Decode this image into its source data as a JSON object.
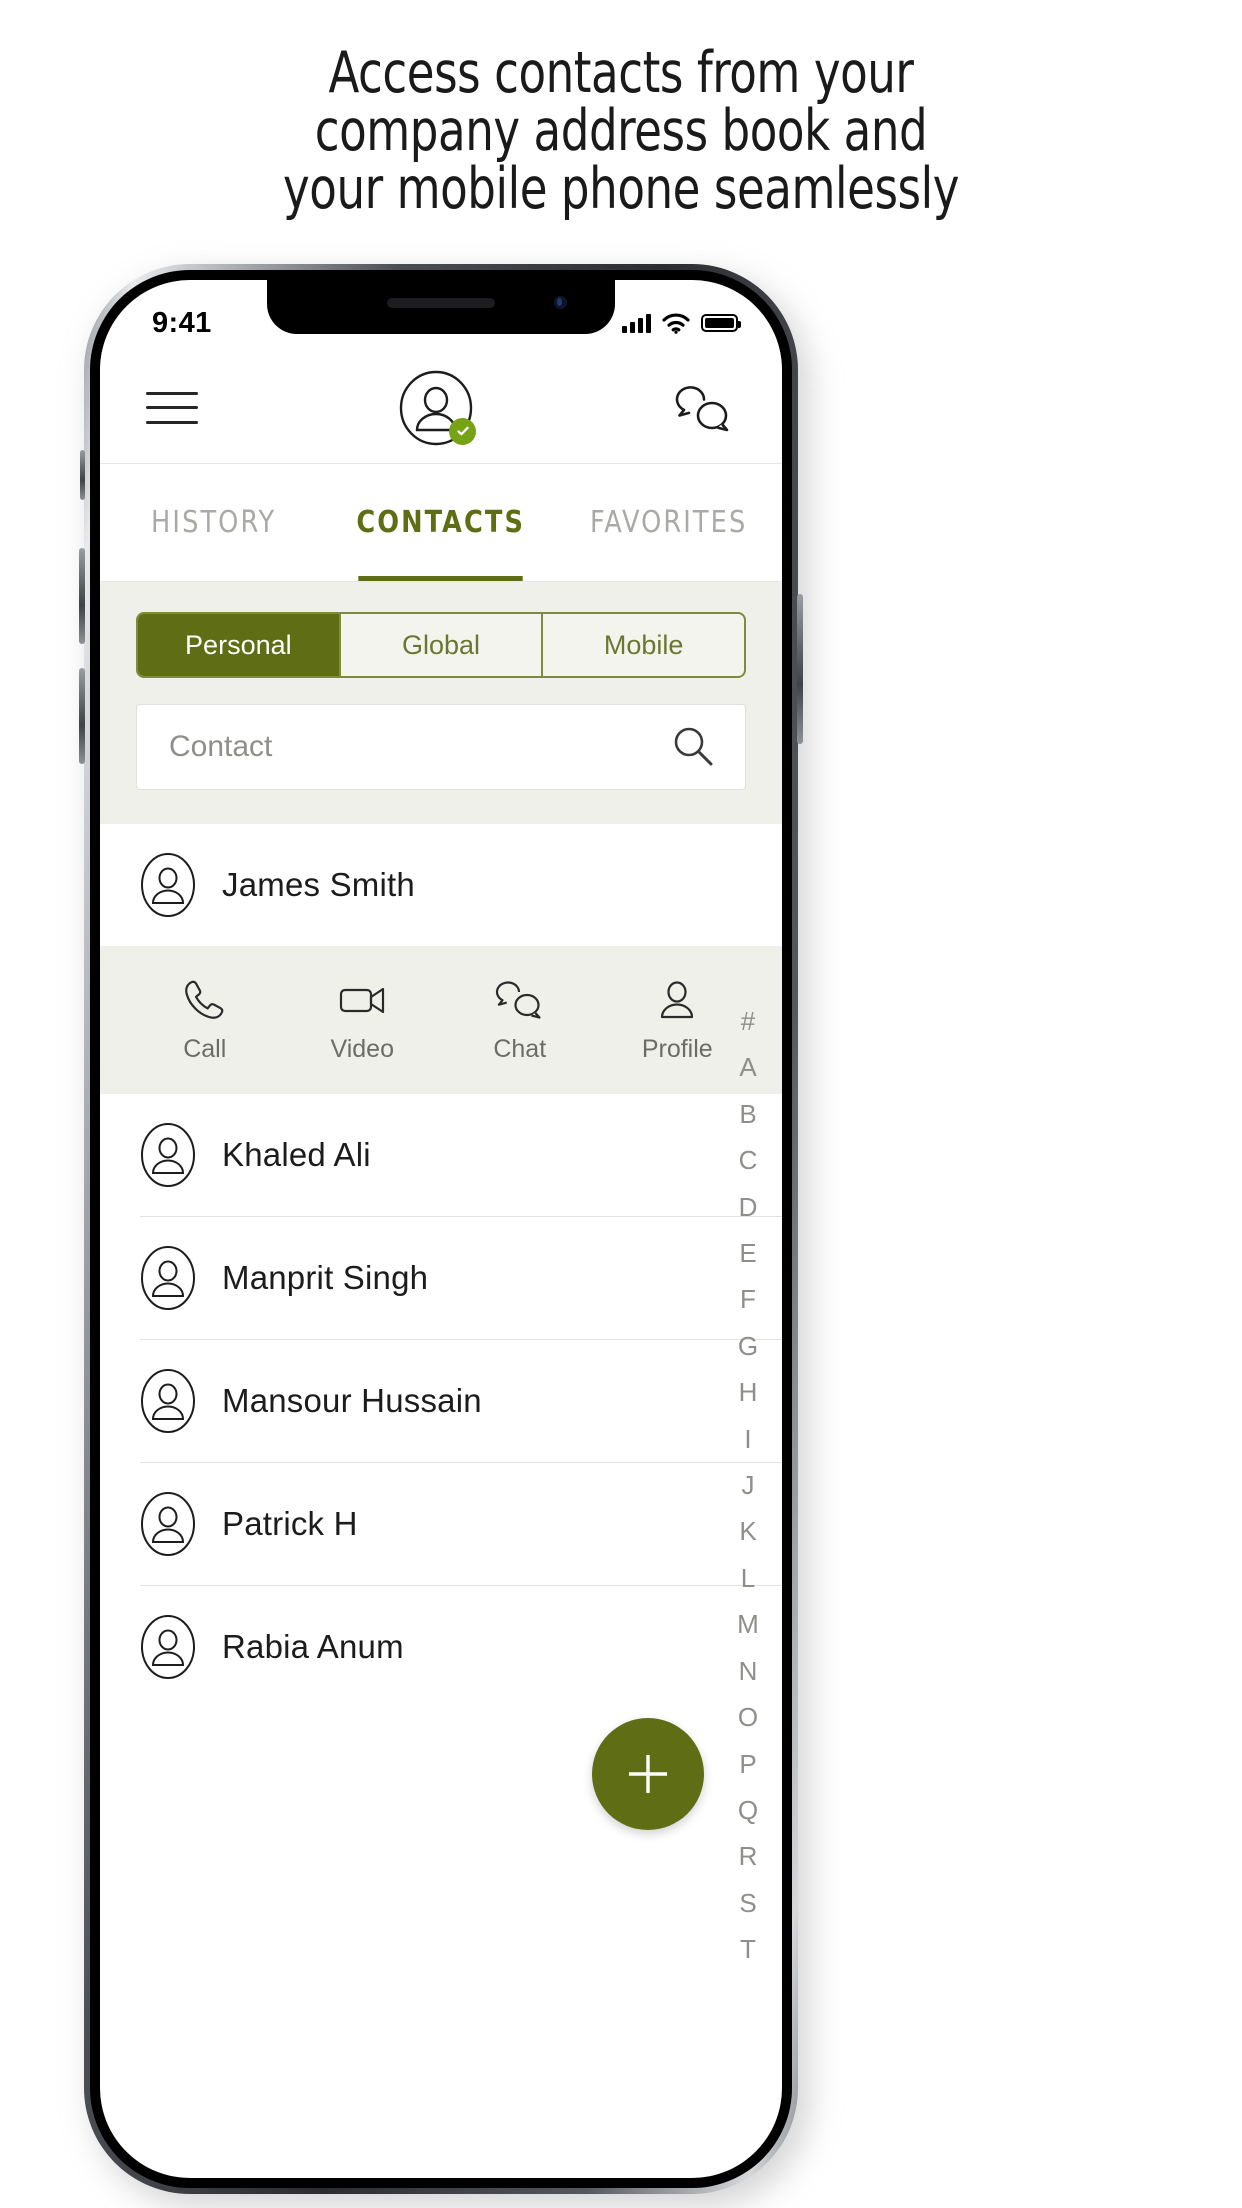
{
  "headline": {
    "lines": [
      "Access contacts from your",
      "company address book and",
      "your mobile phone seamlessly"
    ]
  },
  "colors": {
    "accent_green": "#5f6e14",
    "badge_green": "#76a316",
    "panel_bg": "#f0f0ea",
    "muted_text": "#8e8e8a"
  },
  "statusbar": {
    "time": "9:41",
    "signal_icon": "cellular-signal-icon",
    "wifi_icon": "wifi-icon",
    "battery_icon": "battery-full-icon"
  },
  "header": {
    "menu_icon": "hamburger-menu-icon",
    "avatar_icon": "user-avatar-icon",
    "presence_icon": "available-check-icon",
    "chat_icon": "chat-bubbles-icon"
  },
  "tabs": [
    {
      "label": "HISTORY",
      "active": false
    },
    {
      "label": "CONTACTS",
      "active": true
    },
    {
      "label": "FAVORITES",
      "active": false
    }
  ],
  "filter": {
    "segments": [
      {
        "label": "Personal",
        "active": true
      },
      {
        "label": "Global",
        "active": false
      },
      {
        "label": "Mobile",
        "active": false
      }
    ],
    "search": {
      "value": "",
      "placeholder": "Contact",
      "icon": "search-icon"
    }
  },
  "contacts": [
    {
      "name": "James Smith",
      "expanded": true
    },
    {
      "name": "Khaled Ali",
      "expanded": false
    },
    {
      "name": "Manprit  Singh",
      "expanded": false
    },
    {
      "name": "Mansour Hussain",
      "expanded": false
    },
    {
      "name": "Patrick H",
      "expanded": false
    },
    {
      "name": "Rabia Anum",
      "expanded": false
    }
  ],
  "actions": [
    {
      "label": "Call",
      "icon": "phone-icon"
    },
    {
      "label": "Video",
      "icon": "video-camera-icon"
    },
    {
      "label": "Chat",
      "icon": "chat-bubbles-icon"
    },
    {
      "label": "Profile",
      "icon": "person-icon"
    }
  ],
  "alpha_index": [
    "#",
    "A",
    "B",
    "C",
    "D",
    "E",
    "F",
    "G",
    "H",
    "I",
    "J",
    "K",
    "L",
    "M",
    "N",
    "O",
    "P",
    "Q",
    "R",
    "S",
    "T"
  ],
  "fab": {
    "label": "+",
    "icon": "plus-icon"
  }
}
